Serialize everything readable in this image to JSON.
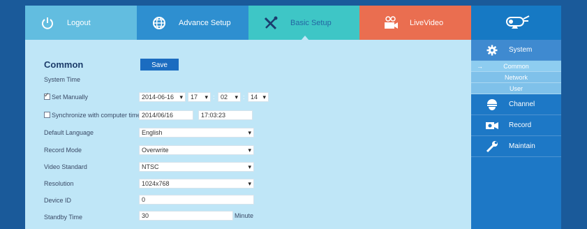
{
  "nav": {
    "logout": "Logout",
    "advance": "Advance Setup",
    "basic": "Basic Setup",
    "live": "LiveVideo",
    "logo_icon": "camera-logo-icon"
  },
  "form": {
    "title": "Common",
    "save": "Save",
    "system_time": "System Time",
    "set_manually": "Set Manually",
    "date": "2014-06-16",
    "hour": "17",
    "minute": "02",
    "second": "14",
    "sync": "Synchronize with computer time",
    "sync_date": "2014/06/16",
    "sync_time": "17:03:23",
    "language_label": "Default Language",
    "language": "English",
    "record_label": "Record Mode",
    "record": "Overwrite",
    "video_label": "Video Standard",
    "video": "NTSC",
    "resolution_label": "Resolution",
    "resolution": "1024x768",
    "device_label": "Device ID",
    "device": "0",
    "standby_label": "Standby Time",
    "standby": "30",
    "minute_unit": "Minute",
    "colon": ":"
  },
  "side": {
    "system": "System",
    "common": "Common",
    "network": "Network",
    "user": "User",
    "channel": "Channel",
    "record": "Record",
    "maintain": "Maintain",
    "arrow": "→"
  },
  "colors": {
    "frame": "#bfe6f7",
    "logout_tab": "#62bde0",
    "advance_tab": "#2e8fd0",
    "basic_tab": "#3ec6c6",
    "live_tab": "#ea6e50",
    "side": "#1d78c6",
    "save": "#1b6cc0"
  }
}
